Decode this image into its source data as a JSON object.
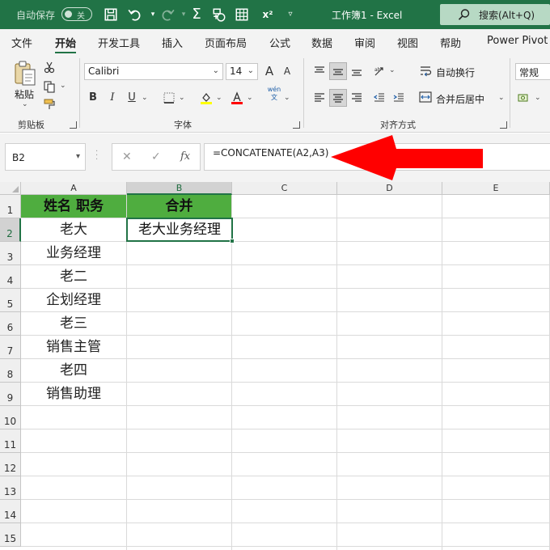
{
  "titlebar": {
    "autosave_label": "自动保存",
    "autosave_state": "关",
    "doc_title": "工作簿1  -  Excel",
    "search_placeholder": "搜索(Alt+Q)",
    "superscript_label": "x²"
  },
  "menu": {
    "tabs": [
      "文件",
      "开始",
      "开发工具",
      "插入",
      "页面布局",
      "公式",
      "数据",
      "审阅",
      "视图",
      "帮助",
      "Power Pivot"
    ],
    "active": "开始"
  },
  "ribbon": {
    "clipboard": {
      "paste_label": "粘贴",
      "group_label": "剪贴板"
    },
    "font": {
      "font_name": "Calibri",
      "font_size": "14",
      "group_label": "字体",
      "bold": "B",
      "italic": "I",
      "underline": "U",
      "grow": "A",
      "shrink": "A",
      "phonetic": "wén"
    },
    "alignment": {
      "wrap_text": "自动换行",
      "merge_center": "合并后居中",
      "group_label": "对齐方式"
    },
    "number": {
      "format": "常规"
    }
  },
  "formula_bar": {
    "name_box": "B2",
    "cancel_symbol": "✕",
    "confirm_symbol": "✓",
    "fx_symbol": "fx",
    "formula": "=CONCATENATE(A2,A3)"
  },
  "annotation": {
    "arrow_color": "#ff0000"
  },
  "sheet": {
    "columns": [
      "A",
      "B",
      "C",
      "D",
      "E"
    ],
    "rows": [
      "1",
      "2",
      "3",
      "4",
      "5",
      "6",
      "7",
      "8",
      "9",
      "10",
      "11",
      "12",
      "13",
      "14",
      "15"
    ],
    "header_fill": "#4fad3f",
    "a1": "姓名 职务",
    "b1": "合并",
    "a_values": [
      "老大",
      "业务经理",
      "老二",
      "企划经理",
      "老三",
      "销售主管",
      "老四",
      "销售助理"
    ],
    "b2": "老大业务经理"
  },
  "colors": {
    "accent": "#217346"
  }
}
